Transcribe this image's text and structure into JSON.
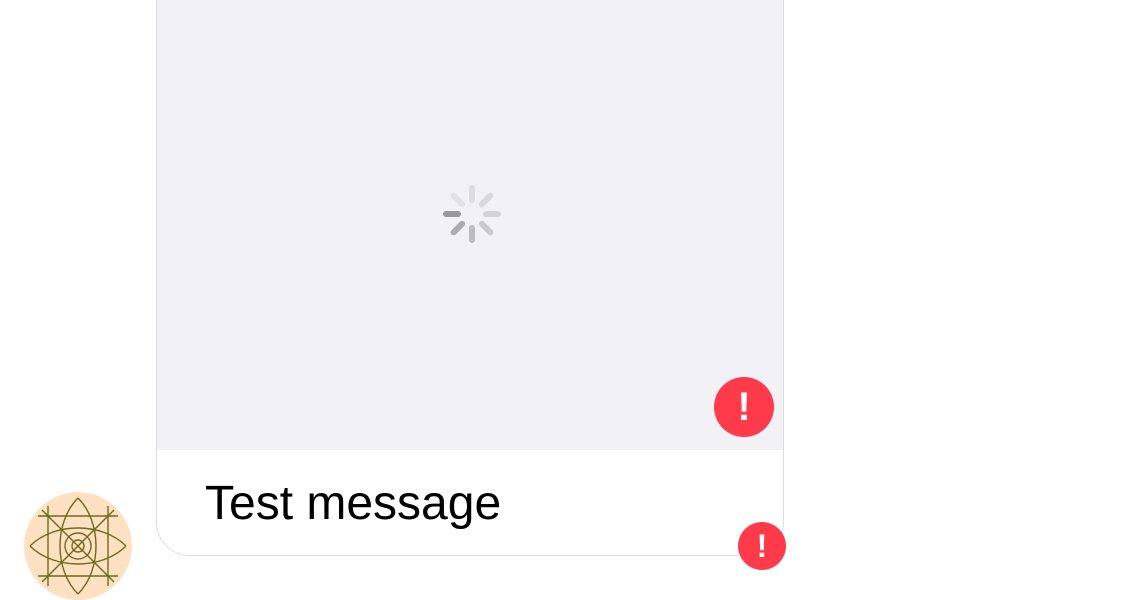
{
  "message": {
    "caption": "Test message",
    "media_state": "loading",
    "media_error_icon": "exclamation-icon",
    "media_error_symbol": "!",
    "send_error_icon": "exclamation-icon",
    "send_error_symbol": "!"
  },
  "avatar": {
    "icon": "geometric-pattern-avatar",
    "background_color": "#ffe0c0",
    "pattern_color": "#6b6b20"
  },
  "colors": {
    "error": "#ff3b4b",
    "media_placeholder": "#f1f1f6",
    "bubble_border": "#dcdce0",
    "spinner": "#8e8e93"
  }
}
